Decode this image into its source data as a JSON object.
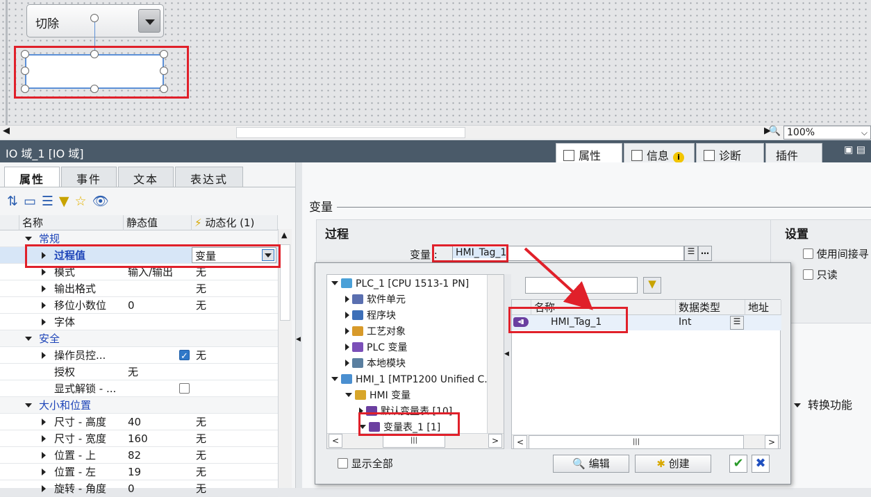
{
  "canvas": {
    "switch_label": "切除",
    "zoom_value": "100%",
    "zoom_options": [
      "100%"
    ]
  },
  "inspector": {
    "title": "IO 域_1 [IO 域]",
    "tabs": [
      {
        "label": "属性",
        "active": true
      },
      {
        "label": "信息",
        "badge": "i"
      },
      {
        "label": "诊断"
      },
      {
        "label": "插件"
      }
    ]
  },
  "left": {
    "subtabs": [
      "属性",
      "事件",
      "文本",
      "表达式"
    ],
    "columns": [
      "名称",
      "静态值",
      "动态化 (1)"
    ],
    "rows": [
      {
        "kind": "group",
        "name": "常规"
      },
      {
        "kind": "item",
        "name": "过程值",
        "static": "",
        "dynamic": "变量",
        "selected": true
      },
      {
        "kind": "item",
        "name": "模式",
        "static": "输入/输出",
        "dynamic": "无"
      },
      {
        "kind": "item",
        "name": "输出格式",
        "static": "",
        "dynamic": "无"
      },
      {
        "kind": "item",
        "name": "移位小数位",
        "static": "0",
        "dynamic": "无"
      },
      {
        "kind": "item",
        "name": "字体",
        "static": "",
        "dynamic": ""
      },
      {
        "kind": "group",
        "name": "安全"
      },
      {
        "kind": "item",
        "name": "操作员控...",
        "static": "",
        "dynamic": "无",
        "checkbox": "on"
      },
      {
        "kind": "leaf",
        "name": "授权",
        "static": "无",
        "dynamic": ""
      },
      {
        "kind": "leaf",
        "name": "显式解锁 - ...",
        "static": "",
        "dynamic": "",
        "checkbox": "off"
      },
      {
        "kind": "group",
        "name": "大小和位置"
      },
      {
        "kind": "item",
        "name": "尺寸 - 高度",
        "static": "40",
        "dynamic": "无"
      },
      {
        "kind": "item",
        "name": "尺寸 - 宽度",
        "static": "160",
        "dynamic": "无"
      },
      {
        "kind": "item",
        "name": "位置 - 上",
        "static": "82",
        "dynamic": "无"
      },
      {
        "kind": "item",
        "name": "位置 - 左",
        "static": "19",
        "dynamic": "无"
      },
      {
        "kind": "item",
        "name": "旋转 - 角度",
        "static": "0",
        "dynamic": "无"
      }
    ]
  },
  "right": {
    "section_label": "变量",
    "process_title": "过程",
    "var_label": "变量 :",
    "var_value": "HMI_Tag_1",
    "settings_title": "设置",
    "settings": [
      {
        "label": "使用间接寻",
        "checked": false
      },
      {
        "label": "只读",
        "checked": false
      }
    ],
    "transform_label": "转换功能"
  },
  "popup": {
    "tree": [
      {
        "label": "PLC_1 [CPU 1513-1 PN]",
        "depth": 0,
        "expanded": true,
        "icon": "plc-icon"
      },
      {
        "label": "软件单元",
        "depth": 1,
        "icon": "software-unit-icon"
      },
      {
        "label": "程序块",
        "depth": 1,
        "icon": "program-block-icon"
      },
      {
        "label": "工艺对象",
        "depth": 1,
        "icon": "technology-object-icon"
      },
      {
        "label": "PLC 变量",
        "depth": 1,
        "icon": "plc-tag-icon"
      },
      {
        "label": "本地模块",
        "depth": 1,
        "icon": "local-module-icon"
      },
      {
        "label": "HMI_1 [MTP1200 Unified C...",
        "depth": 0,
        "expanded": true,
        "icon": "hmi-icon"
      },
      {
        "label": "HMI 变量",
        "depth": 1,
        "expanded": true,
        "icon": "hmi-tag-folder-icon"
      },
      {
        "label": "默认变量表 [10]",
        "depth": 2,
        "icon": "tag-table-icon"
      },
      {
        "label": "变量表_1 [1]",
        "depth": 2,
        "expanded": true,
        "icon": "tag-table-icon",
        "selected": true
      }
    ],
    "filter_placeholder": "",
    "columns": [
      "名称",
      "数据类型",
      "地址"
    ],
    "rows": [
      {
        "name": "HMI_Tag_1",
        "type": "Int",
        "address": ""
      }
    ],
    "show_all_label": "显示全部",
    "edit_label": "编辑",
    "create_label": "创建",
    "ok_symbol": "✔",
    "cancel_symbol": "✖"
  },
  "colors": {
    "highlight_red": "#e0202a",
    "selection_blue": "#5b8fd6",
    "header_dark": "#4a5a69"
  }
}
